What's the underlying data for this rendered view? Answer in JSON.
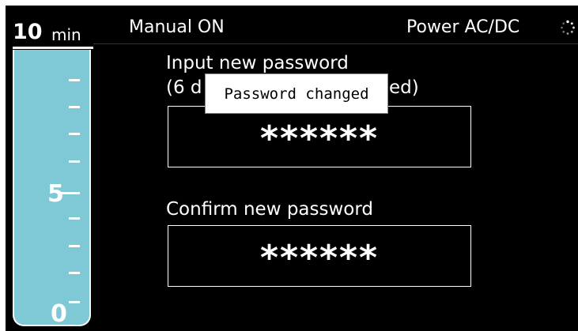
{
  "timer": {
    "value": "10",
    "unit": "min",
    "scale_labels": [
      "5",
      "0"
    ]
  },
  "header": {
    "mode": "Manual ON",
    "power": "Power AC/DC",
    "power_icon": "loading-spinner-icon"
  },
  "form": {
    "new_password_label_line1": "Input new password",
    "new_password_label_line2_start": "(6 d",
    "new_password_label_line2_end": "ed)",
    "new_password_value": "******",
    "confirm_password_label": "Confirm new password",
    "confirm_password_value": "******"
  },
  "toast": {
    "message": "Password changed"
  }
}
